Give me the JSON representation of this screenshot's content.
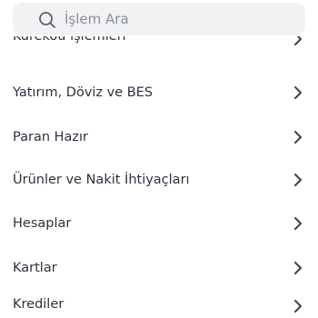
{
  "search": {
    "placeholder": "İşlem Ara",
    "value": ""
  },
  "menu": {
    "items": [
      {
        "label": "Kurekou işlemleri"
      },
      {
        "label": "Yatırım, Döviz ve BES"
      },
      {
        "label": "Paran Hazır"
      },
      {
        "label": "Ürünler ve Nakit İhtiyaçları"
      },
      {
        "label": "Hesaplar"
      },
      {
        "label": "Kartlar"
      },
      {
        "label": "Krediler"
      }
    ]
  },
  "icons": {
    "search": "search-icon",
    "chevron": "chevron-right-icon"
  },
  "colors": {
    "text": "#2b3240",
    "chevron": "#3a4050",
    "search_bg": "#f1f2f4"
  }
}
